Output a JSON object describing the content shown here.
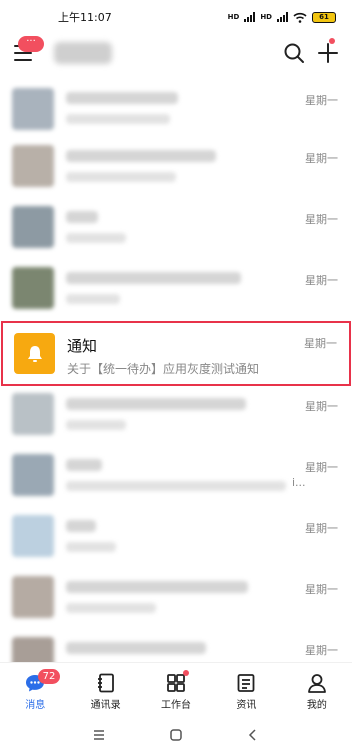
{
  "status_bar": {
    "time": "上午11:07",
    "network_a": "HD",
    "network_b": "HD",
    "battery": "61"
  },
  "header": {
    "menu_badge": "···",
    "menu_icon": "menu-icon",
    "search_icon": "search-icon",
    "add_icon": "plus-icon"
  },
  "chats": [
    {
      "time": "星期一",
      "avatar_color": "#a9b3bd"
    },
    {
      "time": "星期一",
      "avatar_color": "#b8b0a8"
    },
    {
      "time": "星期一",
      "avatar_color": "#8d9aa3"
    },
    {
      "time": "星期一",
      "avatar_color": "#7b8670"
    }
  ],
  "notice": {
    "title": "通知",
    "subtitle": "关于【统一待办】应用灰度测试通知",
    "time": "星期一",
    "icon": "bell-icon",
    "icon_bg": "#f7a910"
  },
  "chats_after": [
    {
      "time": "星期一",
      "avatar_color": "#b9c1c6"
    },
    {
      "time": "星期一",
      "avatar_color": "#9aa8b4",
      "preview_tail": "i..."
    },
    {
      "time": "星期一",
      "avatar_color": "#bcd0e0"
    },
    {
      "time": "星期一",
      "avatar_color": "#b5aba3"
    },
    {
      "time": "星期一",
      "avatar_color": "#a89e97"
    }
  ],
  "tabs": [
    {
      "label": "消息",
      "icon": "chat-icon",
      "badge": "72",
      "active": true
    },
    {
      "label": "通讯录",
      "icon": "contacts-icon"
    },
    {
      "label": "工作台",
      "icon": "grid-icon",
      "dot": true
    },
    {
      "label": "资讯",
      "icon": "news-icon"
    },
    {
      "label": "我的",
      "icon": "person-icon"
    }
  ],
  "colors": {
    "accent_blue": "#2c6ee8",
    "badge_red": "#f24f5f",
    "highlight_red": "#e8324a"
  }
}
